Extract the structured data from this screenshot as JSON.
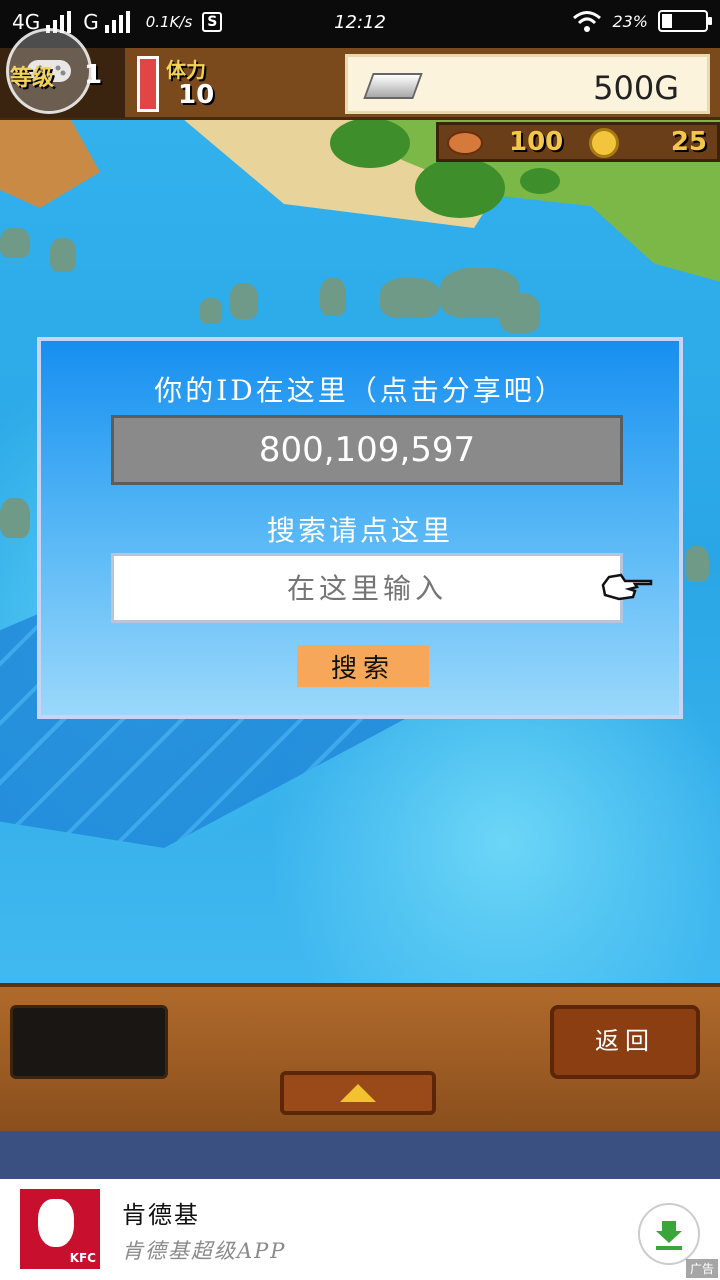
{
  "status_bar": {
    "network1": "4G",
    "network2": "G",
    "speed": "0.1K/s",
    "s_badge": "S",
    "time": "12:12",
    "battery": "23%",
    "battery_level": 0.23
  },
  "hud": {
    "level_label": "等级",
    "level_value": "1",
    "stamina_label": "体力",
    "stamina_value": "10",
    "gold": "500G",
    "food": "100",
    "coins": "25"
  },
  "dialog": {
    "title": "你的ID在这里（点击分享吧）",
    "id_value": "800,109,597",
    "search_label": "搜索请点这里",
    "search_placeholder": "在这里输入",
    "search_button": "搜索"
  },
  "panel": {
    "back_button": "返回"
  },
  "ad": {
    "brand_logo_text": "KFC",
    "title": "肯德基",
    "subtitle": "肯德基超级APP",
    "tag": "广告"
  }
}
